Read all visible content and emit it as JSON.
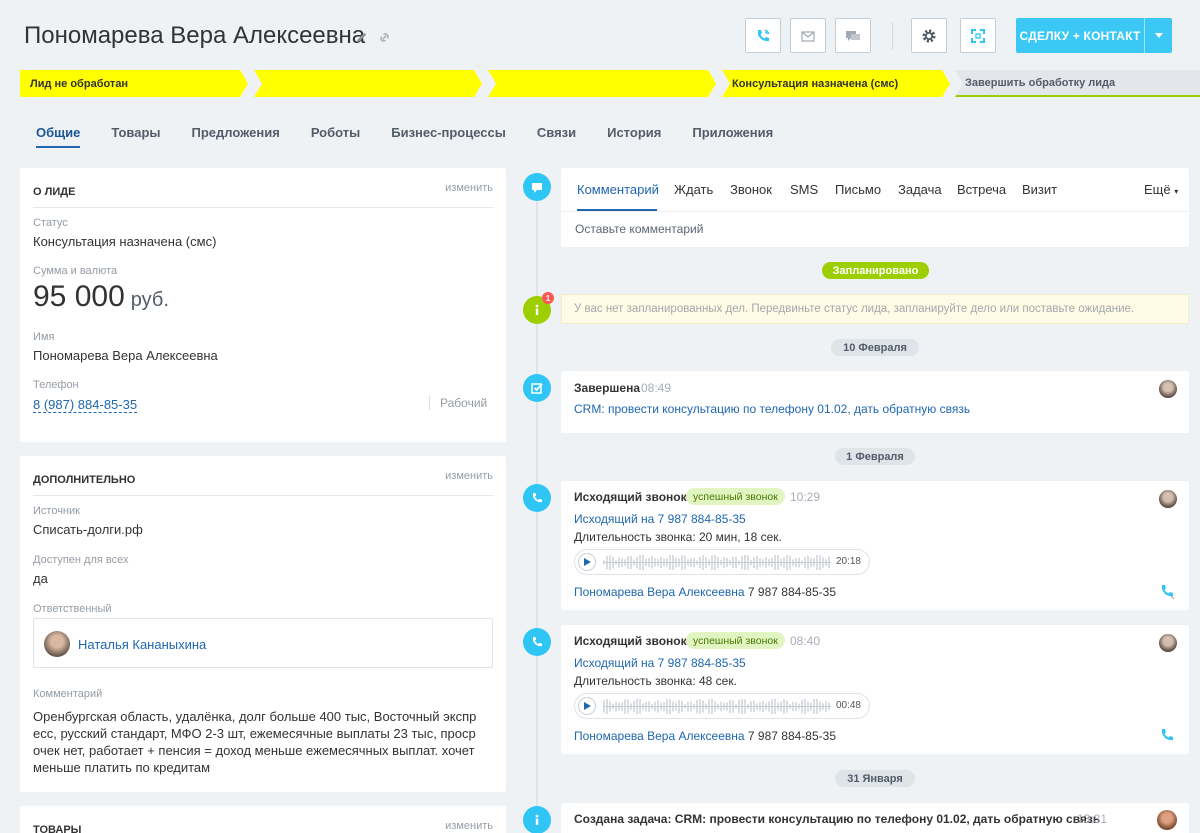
{
  "header": {
    "title": "Пономарева Вера Алексеевна",
    "add_button": "СДЕЛКУ + КОНТАКТ",
    "icons": [
      "edit-icon",
      "link-icon",
      "phone-icon",
      "mail-icon",
      "chat-icon",
      "gear-icon",
      "expand-icon",
      "chevron-down-icon"
    ]
  },
  "stages": [
    {
      "label": "Лид не обработан",
      "color": "#ffff00"
    },
    {
      "label": "",
      "color": "#ffff00"
    },
    {
      "label": "",
      "color": "#ffff00"
    },
    {
      "label": "Консультация назначена (смс)",
      "color": "#ffff00"
    },
    {
      "label": "Завершить обработку лида",
      "color": "#e3e6ea"
    }
  ],
  "tabs": [
    "Общие",
    "Товары",
    "Предложения",
    "Роботы",
    "Бизнес-процессы",
    "Связи",
    "История",
    "Приложения"
  ],
  "about": {
    "title": "О ЛИДЕ",
    "edit": "изменить",
    "status_label": "Статус",
    "status_value": "Консультация назначена (смс)",
    "sum_label": "Сумма и валюта",
    "sum_value": "95 000",
    "sum_currency": "руб.",
    "name_label": "Имя",
    "name_value": "Пономарева Вера Алексеевна",
    "phone_label": "Телефон",
    "phone_value": "8 (987) 884-85-35",
    "phone_type": "Рабочий"
  },
  "additional": {
    "title": "ДОПОЛНИТЕЛЬНО",
    "edit": "изменить",
    "source_label": "Источник",
    "source_value": "Списать-долги.рф",
    "access_label": "Доступен для всех",
    "access_value": "да",
    "resp_label": "Ответственный",
    "resp_value": "Наталья Кананыхина",
    "comment_label": "Комментарий",
    "comment_value": "Оренбургская область, удалёнка, долг больше 400 тыс, Восточный экспр есс, русский стандарт, МФО 2-3 шт, ежемесячные выплаты 23 тыс, проср очек нет, работает + пенсия = доход меньше ежемесячных выплат. хочет меньше платить по кредитам"
  },
  "goods": {
    "title": "ТОВАРЫ",
    "edit": "изменить"
  },
  "editor": {
    "tabs": [
      "Комментарий",
      "Ждать",
      "Звонок",
      "SMS",
      "Письмо",
      "Задача",
      "Встреча",
      "Визит"
    ],
    "more": "Ещё",
    "placeholder": "Оставьте комментарий"
  },
  "timeline": {
    "planned_label": "Запланировано",
    "planned_notice": "У вас нет запланированных дел. Передвиньте статус лида, запланируйте дело или поставьте ожидание.",
    "notice_count": "1",
    "dates": [
      "10 Февраля",
      "1 Февраля",
      "31 Января"
    ],
    "done": {
      "title": "Завершена",
      "time": "08:49",
      "link": "CRM: провести консультацию по телефону 01.02, дать обратную связь"
    },
    "calls": [
      {
        "title": "Исходящий звонок",
        "status": "успешный звонок",
        "time": "10:29",
        "link": "Исходящий на 7 987 884-85-35",
        "duration": "Длительность звонка: 20 мин, 18 сек.",
        "player_time": "20:18",
        "contact_name": "Пономарева Вера Алексеевна",
        "contact_phone": "7 987 884-85-35"
      },
      {
        "title": "Исходящий звонок",
        "status": "успешный звонок",
        "time": "08:40",
        "link": "Исходящий на 7 987 884-85-35",
        "duration": "Длительность звонка: 48 сек.",
        "player_time": "00:48",
        "contact_name": "Пономарева Вера Алексеевна",
        "contact_phone": "7 987 884-85-35"
      }
    ],
    "task": {
      "title": "Создана задача: CRM: провести консультацию по телефону 01.02, дать обратную связь",
      "time": "13:31"
    }
  }
}
